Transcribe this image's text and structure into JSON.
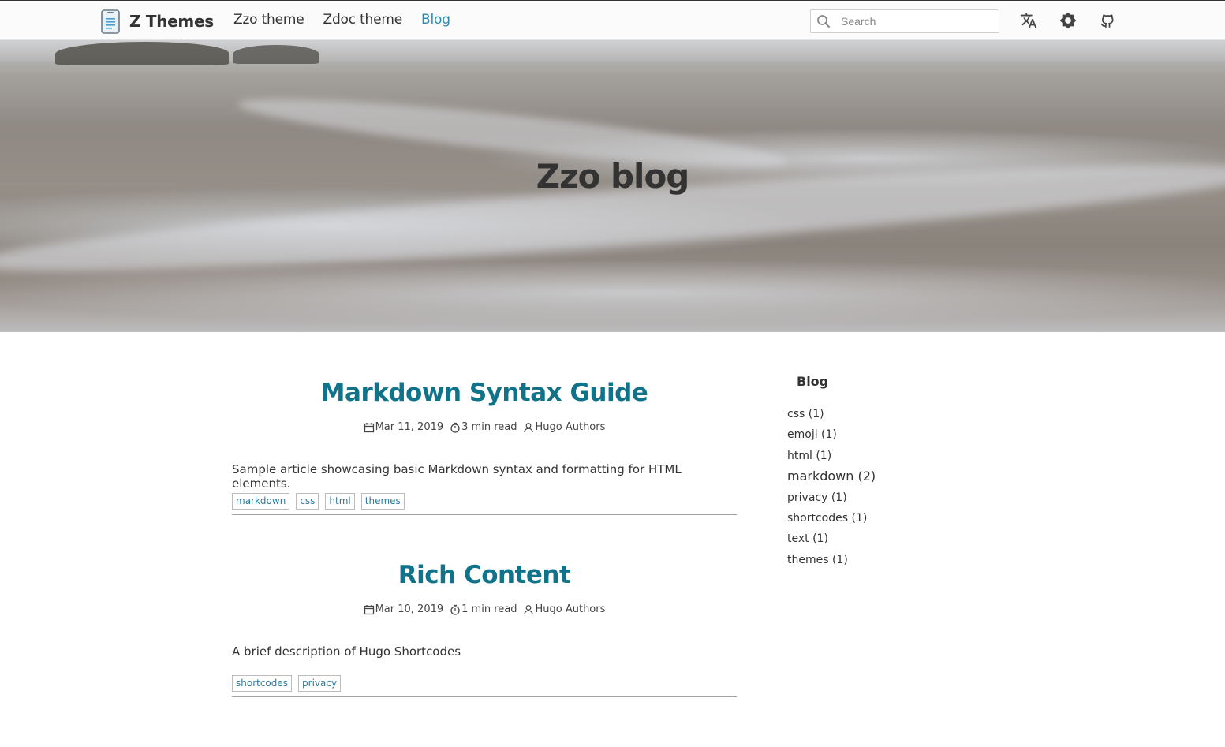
{
  "navbar": {
    "brand": "Z Themes",
    "links": [
      "Zzo theme",
      "Zdoc theme",
      "Blog"
    ],
    "active_link": "Blog",
    "search": {
      "placeholder": "Search",
      "value": ""
    },
    "icons": [
      "translate-icon",
      "theme-toggle-icon",
      "github-icon"
    ]
  },
  "hero": {
    "title": "Zzo blog"
  },
  "posts": [
    {
      "title": "Markdown Syntax Guide",
      "date": "Mar 11, 2019",
      "read_time": "3 min read",
      "author": "Hugo Authors",
      "summary": "Sample article showcasing basic Markdown syntax and formatting for HTML elements.",
      "tags": [
        "markdown",
        "css",
        "html",
        "themes"
      ]
    },
    {
      "title": "Rich Content",
      "date": "Mar 10, 2019",
      "read_time": "1 min read",
      "author": "Hugo Authors",
      "summary": "A brief description of Hugo Shortcodes",
      "tags": [
        "shortcodes",
        "privacy"
      ]
    }
  ],
  "sidebar": {
    "title": "Blog",
    "tags": [
      "css (1)",
      "emoji (1)",
      "html (1)",
      "markdown (2)",
      "privacy (1)",
      "shortcodes (1)",
      "text (1)",
      "themes (1)"
    ]
  },
  "colors": {
    "accent": "#117389",
    "nav_active": "#2a8bb0",
    "tag_text": "#2a7da0"
  }
}
